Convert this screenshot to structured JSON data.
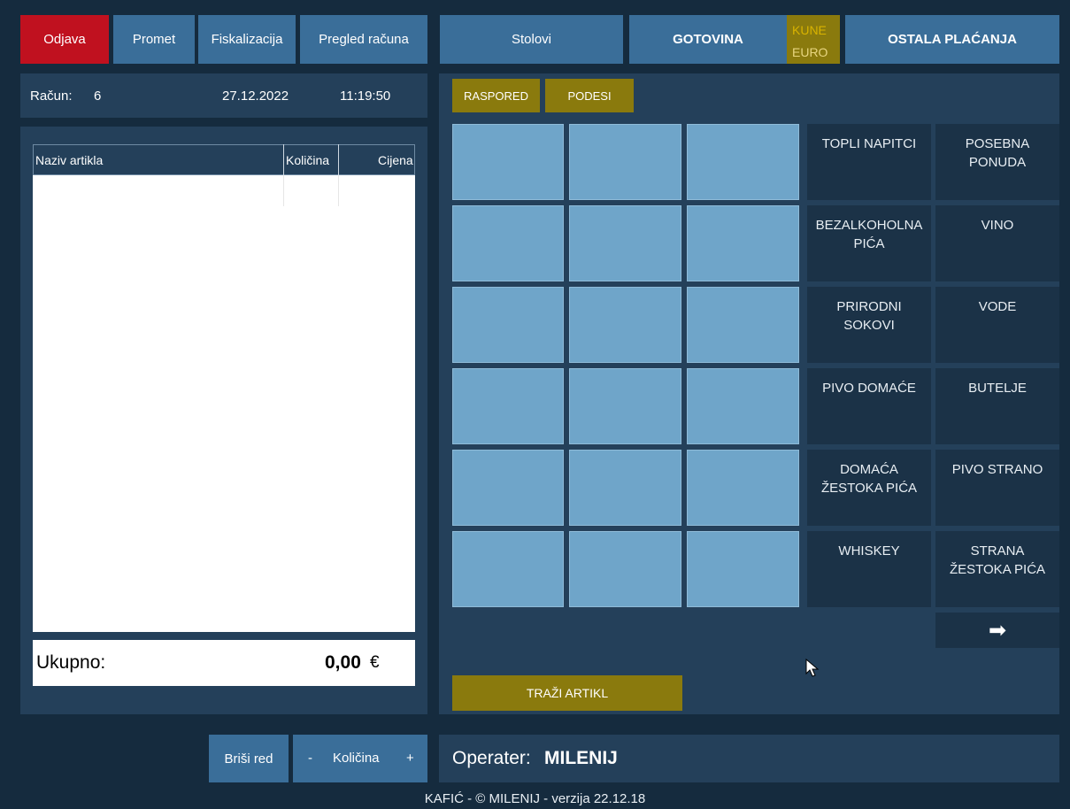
{
  "toolbar": {
    "logout": "Odjava",
    "turnover": "Promet",
    "fiscalization": "Fiskalizacija",
    "receipts": "Pregled računa",
    "tables": "Stolovi",
    "cash": "GOTOVINA",
    "currency_kune": "KUNE",
    "currency_euro": "EURO",
    "other_payments": "OSTALA PLAĆANJA"
  },
  "receipt": {
    "label": "Račun:",
    "number": "6",
    "date": "27.12.2022",
    "time": "11:19:50",
    "columns": [
      "Naziv artikla",
      "Količina",
      "Cijena"
    ],
    "total_label": "Ukupno:",
    "total_value": "0,00",
    "currency_symbol": "€"
  },
  "layout_tabs": {
    "schedule": "RASPORED",
    "settings": "PODESI"
  },
  "categories": [
    [
      "TOPLI NAPITCI",
      "POSEBNA PONUDA"
    ],
    [
      "BEZALKOHOLNA PIĆA",
      "VINO"
    ],
    [
      "PRIRODNI SOKOVI",
      "VODE"
    ],
    [
      "PIVO DOMAĆE",
      "BUTELJE"
    ],
    [
      "DOMAĆA ŽESTOKA PIĆA",
      "PIVO STRANO"
    ],
    [
      "WHISKEY",
      "STRANA ŽESTOKA PIĆA"
    ]
  ],
  "next_arrow": "➡",
  "search_article": "TRAŽI ARTIKL",
  "bottom": {
    "delete_row": "Briši red",
    "qty_minus": "-",
    "qty_label": "Količina",
    "qty_plus": "+",
    "operator_label": "Operater:",
    "operator_name": "MILENIJ"
  },
  "footer": "KAFIĆ - © MILENIJ - verzija 22.12.18",
  "colors": {
    "background": "#152b3e",
    "button_blue": "#3a6e99",
    "logout_red": "#c0111f",
    "olive": "#8a7a0d",
    "tile_blue": "#6fa5c9",
    "category_dark": "#1b3247"
  }
}
